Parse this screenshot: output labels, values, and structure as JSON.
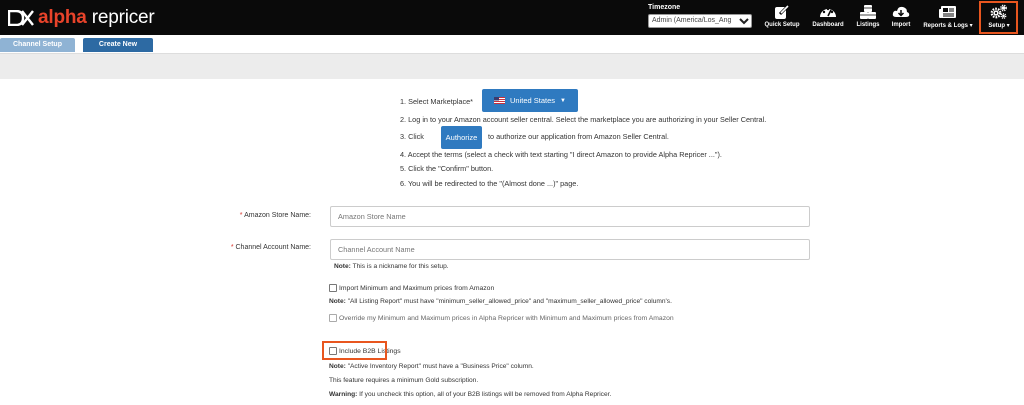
{
  "header": {
    "logo_alpha": "alpha",
    "logo_rest": " repricer",
    "timezone_label": "Timezone",
    "timezone_value": "Admin (America/Los_Ang",
    "nav": {
      "quick_setup": "Quick Setup",
      "dashboard": "Dashboard",
      "listings": "Listings",
      "import": "Import",
      "reports_logs": "Reports & Logs",
      "setup": "Setup"
    }
  },
  "tabs": {
    "channel_setup": "Channel Setup",
    "create_new": "Create New"
  },
  "steps": {
    "s1": "1. Select Marketplace*",
    "marketplace_value": "United States",
    "s2": "2. Log in to your Amazon account seller central. Select the marketplace you are authorizing in your Seller Central.",
    "s3_prefix": "3. Click",
    "authorize_label": "Authorize",
    "s3_suffix": "to authorize our application from Amazon Seller Central.",
    "s4": "4. Accept the terms (select a check with text starting \"I direct Amazon to provide Alpha Repricer ...\").",
    "s5": "5. Click the \"Confirm\" button.",
    "s6": "6. You will be redirected to the \"(Almost done ...)\" page."
  },
  "form": {
    "store_name_label": "Amazon Store Name:",
    "store_name_placeholder": "Amazon Store Name",
    "account_name_label": "Channel Account Name:",
    "account_name_placeholder": "Channel Account Name",
    "required_mark": "*",
    "nickname_note_bold": "Note:",
    "nickname_note": " This is a nickname for this setup.",
    "import_minmax_label": "Import Minimum and Maximum prices from Amazon",
    "listing_note_bold": "Note:",
    "listing_note": " \"All Listing Report\" must have \"minimum_seller_allowed_price\" and \"maximum_seller_allowed_price\" column's.",
    "override_label": "Override my Minimum and Maximum prices in Alpha Repricer with Minimum and Maximum prices from Amazon",
    "b2b_label": "Include B2B Listings",
    "b2b_note_bold": "Note:",
    "b2b_note": " \"Active Inventory Report\" must have a \"Business Price\" column.",
    "gold_note": "This feature requires a minimum Gold subscription.",
    "warning_bold": "Warning:",
    "warning_note": " If you uncheck this option, all of your B2B listings will be removed from Alpha Repricer."
  },
  "colors": {
    "header_bg": "#0a0a0a",
    "brand_red": "#e8432a",
    "button_blue": "#2f7ac0",
    "highlight_orange": "#e8561f"
  }
}
